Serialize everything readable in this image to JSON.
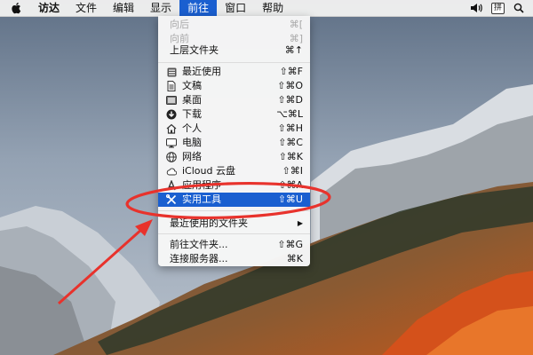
{
  "menubar": {
    "items": [
      "访达",
      "文件",
      "编辑",
      "显示",
      "前往",
      "窗口",
      "帮助"
    ],
    "active_index": 4,
    "input_method": "拼"
  },
  "go_menu": {
    "back": {
      "label": "向后",
      "shortcut": "⌘["
    },
    "forward": {
      "label": "向前",
      "shortcut": "⌘]"
    },
    "enclosing": {
      "label": "上层文件夹",
      "shortcut": "⌘↑"
    },
    "recents": {
      "label": "最近使用",
      "shortcut": "⇧⌘F"
    },
    "documents": {
      "label": "文稿",
      "shortcut": "⇧⌘O"
    },
    "desktop": {
      "label": "桌面",
      "shortcut": "⇧⌘D"
    },
    "downloads": {
      "label": "下载",
      "shortcut": "⌥⌘L"
    },
    "home": {
      "label": "个人",
      "shortcut": "⇧⌘H"
    },
    "computer": {
      "label": "电脑",
      "shortcut": "⇧⌘C"
    },
    "network": {
      "label": "网络",
      "shortcut": "⇧⌘K"
    },
    "icloud": {
      "label": "iCloud 云盘",
      "shortcut": "⇧⌘I"
    },
    "applications": {
      "label": "应用程序",
      "shortcut": "⇧⌘A"
    },
    "utilities": {
      "label": "实用工具",
      "shortcut": "⇧⌘U"
    },
    "recent_folders": {
      "label": "最近使用的文件夹",
      "shortcut": "▶"
    },
    "goto_folder": {
      "label": "前往文件夹...",
      "shortcut": "⇧⌘G"
    },
    "connect_server": {
      "label": "连接服务器...",
      "shortcut": "⌘K"
    }
  },
  "colors": {
    "selection": "#1a5fd0",
    "annotation": "#e8322c"
  },
  "icons": {
    "apple": "apple-icon",
    "volume": "volume-icon",
    "recents": "clock-icon",
    "documents": "document-icon",
    "desktop": "desktop-icon",
    "downloads": "download-icon",
    "home": "home-icon",
    "computer": "computer-icon",
    "network": "globe-icon",
    "icloud": "cloud-icon",
    "applications": "applications-icon",
    "utilities": "utilities-icon"
  }
}
